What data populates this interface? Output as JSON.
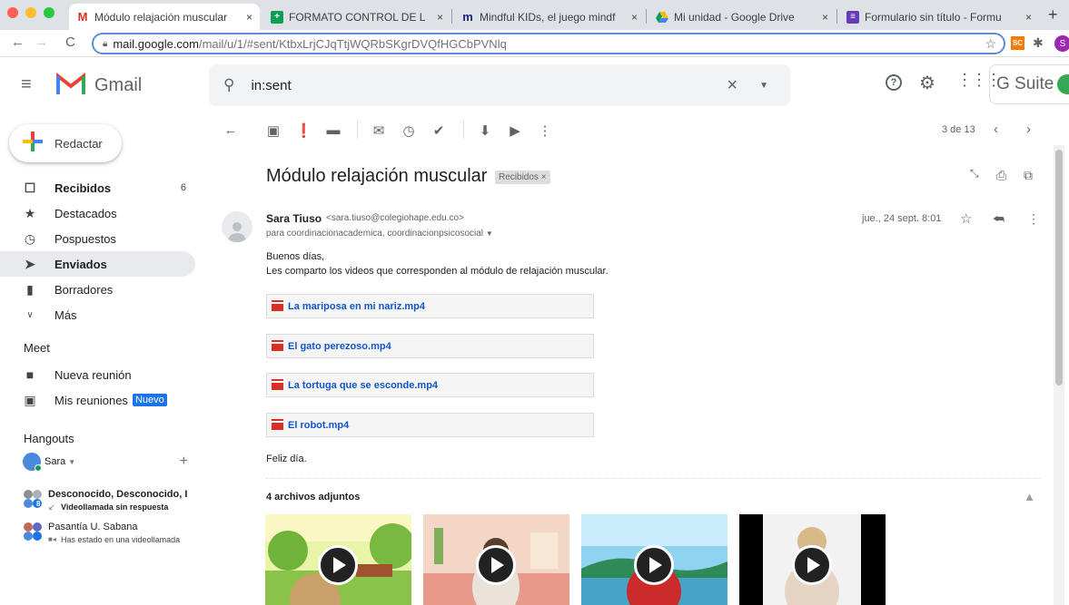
{
  "browser": {
    "tabs": [
      {
        "title": "Módulo relajación muscular - s",
        "favicon": "gmail-icon",
        "active": true
      },
      {
        "title": "FORMATO CONTROL DE LLAM",
        "favicon": "sheets-icon",
        "active": false
      },
      {
        "title": "Mindful KIDs, el juego mindful",
        "favicon": "m-icon",
        "active": false
      },
      {
        "title": "Mi unidad - Google Drive",
        "favicon": "drive-icon",
        "active": false
      },
      {
        "title": "Formulario sin título - Formular",
        "favicon": "forms-icon",
        "active": false
      }
    ],
    "tab_close": "×",
    "new_tab": "+",
    "url_host": "mail.google.com",
    "url_path": "/mail/u/1/#sent/KtbxLrjCJqTtjWQRbSKgrDVQfHGCbPVNlq",
    "ext_badge": "SC",
    "profile_initial": "S"
  },
  "gmail": {
    "logo_text": "Gmail",
    "search_value": "in:sent",
    "suite_text": "G Suite",
    "compose_label": "Redactar",
    "nav": [
      {
        "label": "Recibidos",
        "icon": "inbox-icon",
        "count": "6",
        "bold": true
      },
      {
        "label": "Destacados",
        "icon": "star-icon",
        "count": "",
        "bold": false
      },
      {
        "label": "Pospuestos",
        "icon": "clock-icon",
        "count": "",
        "bold": false
      },
      {
        "label": "Enviados",
        "icon": "send-icon",
        "count": "",
        "bold": true
      },
      {
        "label": "Borradores",
        "icon": "draft-icon",
        "count": "",
        "bold": false
      },
      {
        "label": "Más",
        "icon": "chevron-down-icon",
        "count": "",
        "bold": false
      }
    ],
    "meet": {
      "heading": "Meet",
      "new_meeting": "Nueva reunión",
      "my_meetings": "Mis reuniones",
      "new_badge": "Nuevo"
    },
    "hangouts": {
      "heading": "Hangouts",
      "user": "Sara",
      "add": "+",
      "conversations": [
        {
          "name": "Desconocido, Desconocido, I",
          "status": "Videollamada sin respuesta",
          "bold": true,
          "badge": "8"
        },
        {
          "name": "Pasantía U. Sabana",
          "status": "Has estado en una videollamada",
          "bold": false,
          "badge": ""
        }
      ]
    },
    "toolbar": {
      "pagination": "3 de 13"
    },
    "message": {
      "subject": "Módulo relajación muscular",
      "label_chip": "Recibidos",
      "label_close": "×",
      "sender_name": "Sara Tiuso",
      "sender_email": "<sara.tiuso@colegiohape.edu.co>",
      "recipients": "para coordinacionacademica, coordinacionpsicosocial",
      "date": "jue., 24 sept. 8:01",
      "greeting": "Buenos días,",
      "body_line": "Les comparto los videos que corresponden al módulo de relajación muscular.",
      "attachments_inline": [
        "La mariposa en mi nariz.mp4",
        "El gato perezoso.mp4",
        "La tortuga que se esconde.mp4",
        "El robot.mp4"
      ],
      "closing": "Feliz día.",
      "attachments_heading": "4 archivos adjuntos"
    }
  }
}
